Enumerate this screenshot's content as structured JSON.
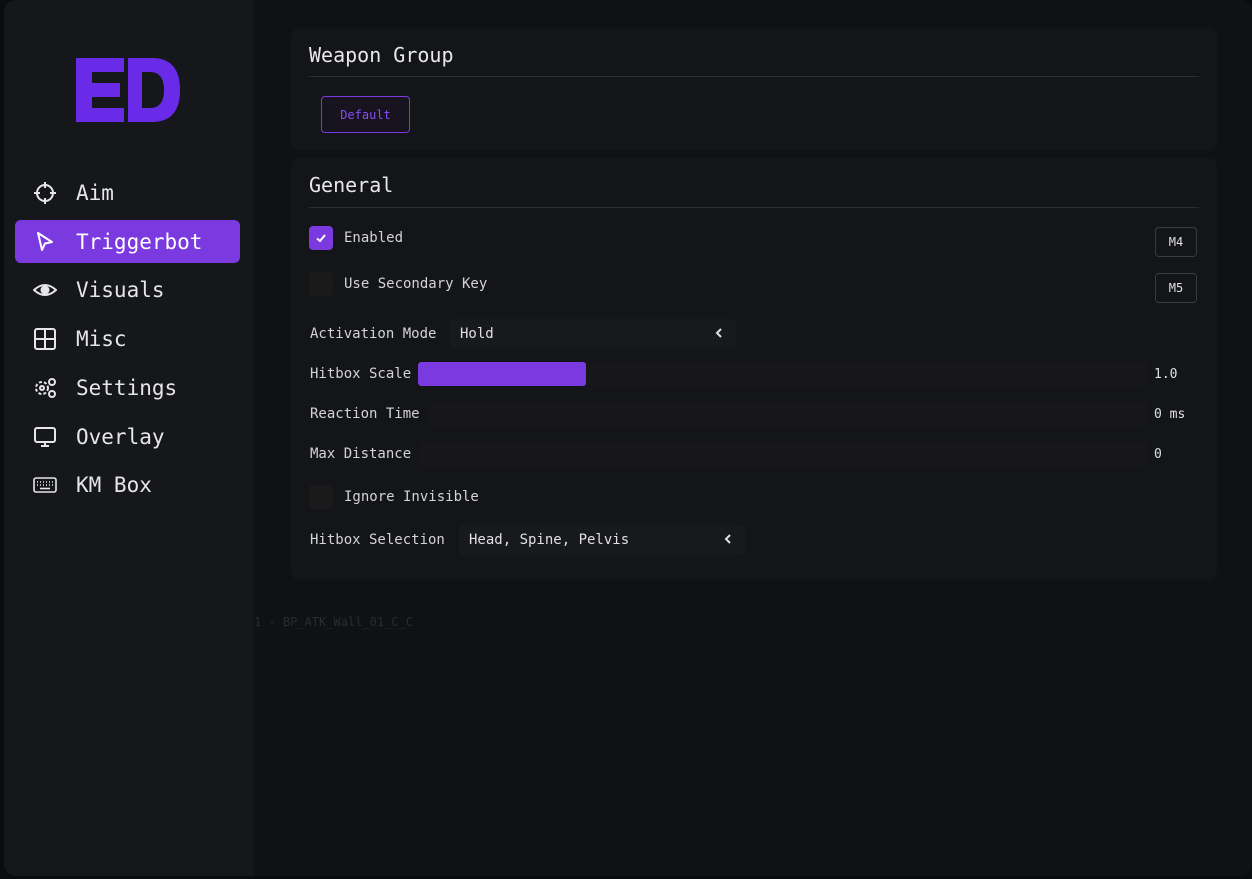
{
  "logo_text": "ED",
  "sidebar": {
    "items": [
      {
        "label": "Aim",
        "icon": "crosshair-icon",
        "active": false
      },
      {
        "label": "Triggerbot",
        "icon": "cursor-icon",
        "active": true
      },
      {
        "label": "Visuals",
        "icon": "eye-icon",
        "active": false
      },
      {
        "label": "Misc",
        "icon": "grid-icon",
        "active": false
      },
      {
        "label": "Settings",
        "icon": "gears-icon",
        "active": false
      },
      {
        "label": "Overlay",
        "icon": "monitor-icon",
        "active": false
      },
      {
        "label": "KM Box",
        "icon": "keyboard-icon",
        "active": false
      }
    ]
  },
  "weapon_group": {
    "title": "Weapon Group",
    "default_label": "Default"
  },
  "general": {
    "title": "General",
    "enabled_label": "Enabled",
    "enabled_checked": true,
    "enabled_key": "M4",
    "secondary_label": "Use Secondary Key",
    "secondary_checked": false,
    "secondary_key": "M5",
    "activation_mode_label": "Activation Mode",
    "activation_mode_value": "Hold",
    "hitbox_scale_label": "Hitbox Scale",
    "hitbox_scale_value": "1.0",
    "hitbox_scale_fraction": 0.23,
    "reaction_time_label": "Reaction Time",
    "reaction_time_value": "0 ms",
    "reaction_time_fraction": 0,
    "max_distance_label": "Max Distance",
    "max_distance_value": "0",
    "max_distance_fraction": 0,
    "ignore_invisible_label": "Ignore Invisible",
    "ignore_invisible_checked": false,
    "hitbox_selection_label": "Hitbox Selection",
    "hitbox_selection_value": "Head, Spine, Pelvis"
  },
  "background_text": "1 - BP_ATK_Wall_01_C_C",
  "colors": {
    "accent": "#7b3ae0",
    "background": "#111214",
    "sidebar": "#16171a"
  }
}
